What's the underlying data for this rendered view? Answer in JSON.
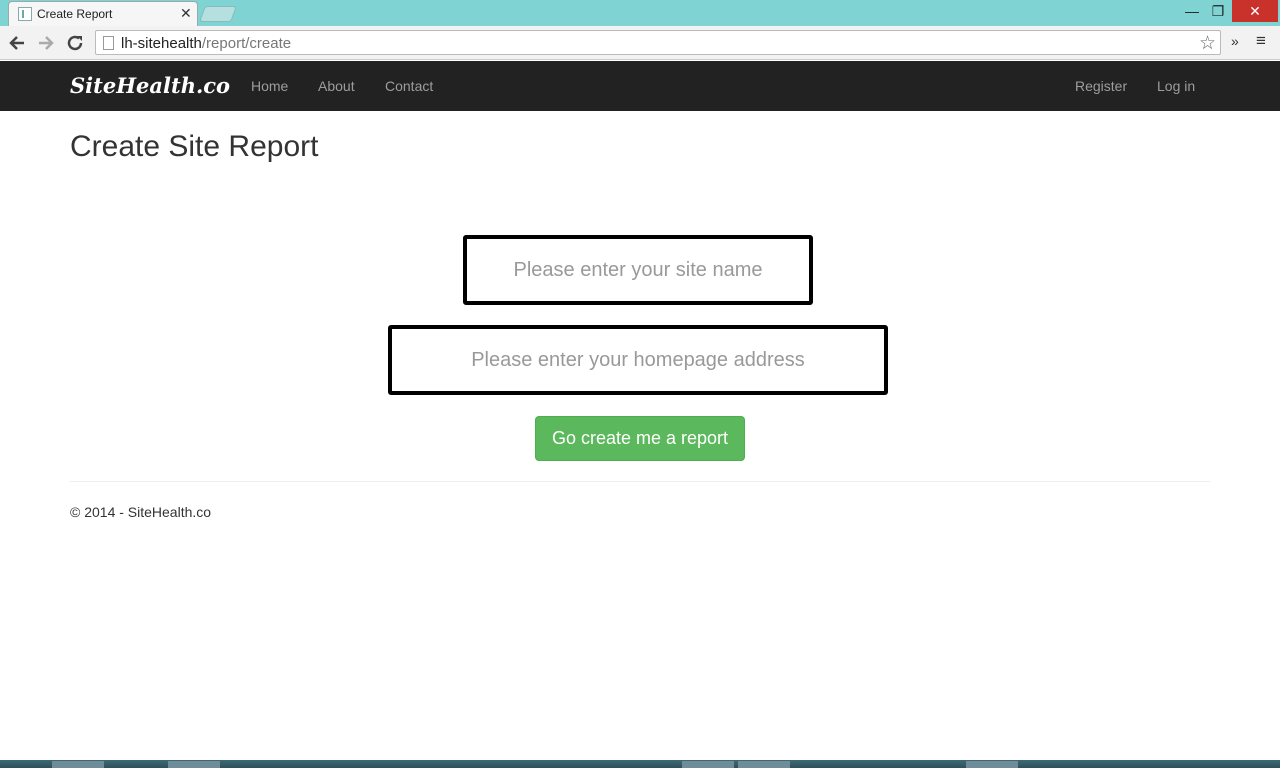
{
  "browser": {
    "tab_title": "Create Report",
    "tab_close": "✕",
    "url_host": "lh-sitehealth",
    "url_path": "/report/create",
    "window_controls": {
      "minimize": "—",
      "maximize": "❐",
      "close": "✕"
    },
    "extensions_label": "»",
    "menu_label": "≡"
  },
  "navbar": {
    "brand": "SiteHealth.co",
    "links": [
      "Home",
      "About",
      "Contact"
    ],
    "right_links": [
      "Register",
      "Log in"
    ]
  },
  "main": {
    "title": "Create Site Report",
    "site_name_placeholder": "Please enter your site name",
    "homepage_placeholder": "Please enter your homepage address",
    "submit_label": "Go create me a report"
  },
  "footer": {
    "text": "© 2014 - SiteHealth.co"
  }
}
